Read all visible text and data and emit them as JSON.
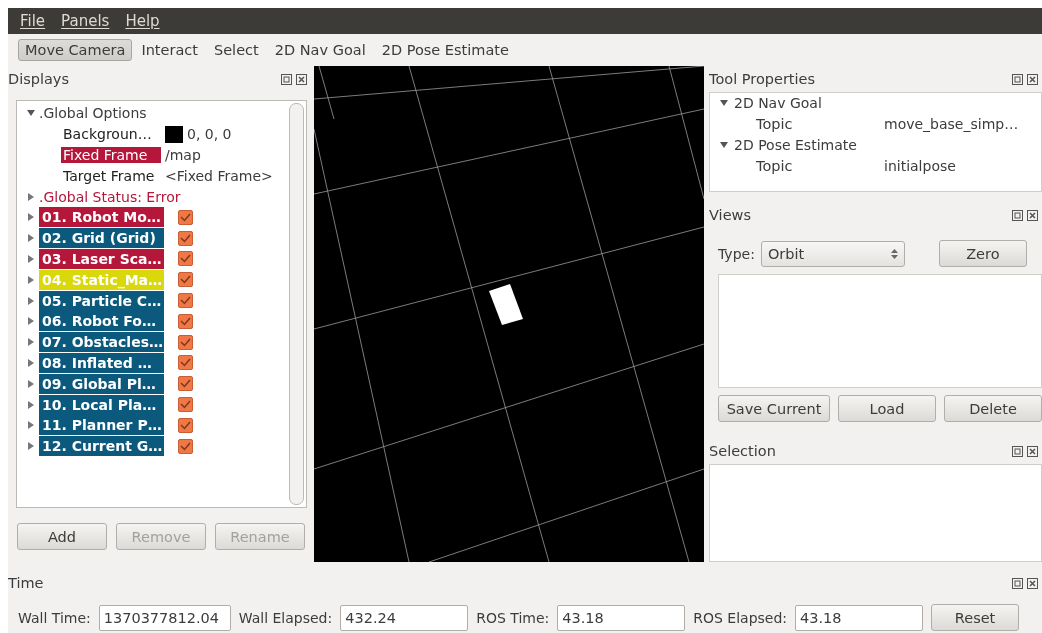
{
  "menu": [
    "File",
    "Panels",
    "Help"
  ],
  "toolbar": [
    {
      "label": "Move Camera",
      "selected": true
    },
    {
      "label": "Interact",
      "selected": false
    },
    {
      "label": "Select",
      "selected": false
    },
    {
      "label": "2D Nav Goal",
      "selected": false
    },
    {
      "label": "2D Pose Estimate",
      "selected": false
    }
  ],
  "displays": {
    "title": "Displays",
    "global_options": {
      "label": ".Global Options",
      "expanded": true,
      "properties": [
        {
          "name": "Backgroun…",
          "value": "0, 0, 0",
          "kind": "color",
          "color": "#000000",
          "error": false
        },
        {
          "name": "Fixed Frame",
          "value": "/map",
          "kind": "text",
          "error": true
        },
        {
          "name": "Target Frame",
          "value": "<Fixed Frame>",
          "kind": "text",
          "error": false
        }
      ]
    },
    "global_status": {
      "label": ".Global Status: Error",
      "expanded": false
    },
    "items": [
      {
        "label": "01. Robot Mo…",
        "color": "#b5173a",
        "checked": true
      },
      {
        "label": "02. Grid (Grid)",
        "color": "#0b5a7e",
        "checked": true
      },
      {
        "label": "03. Laser Sca…",
        "color": "#b5173a",
        "checked": true
      },
      {
        "label": "04. Static_Ma…",
        "color": "#d8d80a",
        "checked": true
      },
      {
        "label": "05. Particle C…",
        "color": "#0b5a7e",
        "checked": true
      },
      {
        "label": "06. Robot Fo…",
        "color": "#0b5a7e",
        "checked": true
      },
      {
        "label": "07. Obstacles…",
        "color": "#0b5a7e",
        "checked": true
      },
      {
        "label": "08. Inflated …",
        "color": "#0b5a7e",
        "checked": true
      },
      {
        "label": "09. Global Pl…",
        "color": "#0b5a7e",
        "checked": true
      },
      {
        "label": "10. Local Pla…",
        "color": "#0b5a7e",
        "checked": true
      },
      {
        "label": "11. Planner P…",
        "color": "#0b5a7e",
        "checked": true
      },
      {
        "label": "12. Current G…",
        "color": "#0b5a7e",
        "checked": true
      }
    ],
    "buttons": [
      {
        "label": "Add",
        "disabled": false
      },
      {
        "label": "Remove",
        "disabled": true
      },
      {
        "label": "Rename",
        "disabled": true
      }
    ]
  },
  "tool_properties": {
    "title": "Tool Properties",
    "tools": [
      {
        "label": "2D Nav Goal",
        "expanded": true,
        "property": "Topic",
        "value": "move_base_simp…"
      },
      {
        "label": "2D Pose Estimate",
        "expanded": true,
        "property": "Topic",
        "value": "initialpose"
      }
    ]
  },
  "views": {
    "title": "Views",
    "type_label": "Type:",
    "type_value": "Orbit",
    "zero": "Zero",
    "buttons": [
      "Save Current",
      "Load",
      "Delete"
    ]
  },
  "selection": {
    "title": "Selection"
  },
  "time": {
    "title": "Time",
    "fields": [
      {
        "label": "Wall Time:",
        "value": "1370377812.04"
      },
      {
        "label": "Wall Elapsed:",
        "value": "432.24"
      },
      {
        "label": "ROS Time:",
        "value": "43.18"
      },
      {
        "label": "ROS Elapsed:",
        "value": "43.18"
      }
    ],
    "reset": "Reset"
  }
}
